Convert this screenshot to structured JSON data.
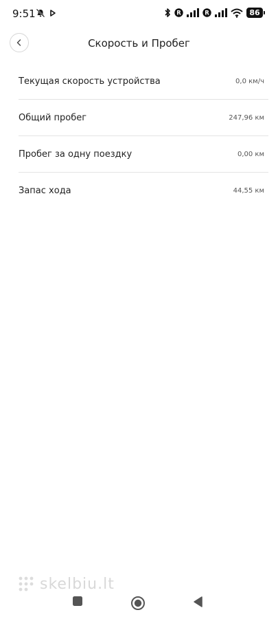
{
  "status_bar": {
    "time": "9:51",
    "battery": "86",
    "icons": [
      "muted-notifications-icon",
      "play-icon",
      "bluetooth-icon",
      "roaming-r-icon",
      "signal-icon",
      "roaming-r-icon",
      "signal-icon",
      "wifi-icon",
      "battery-icon"
    ]
  },
  "header": {
    "title": "Скорость и Пробег",
    "back_icon": "chevron-left-icon"
  },
  "items": [
    {
      "label": "Текущая скорость устройства",
      "value": "0,0 км/ч"
    },
    {
      "label": "Общий пробег",
      "value": "247,96 км"
    },
    {
      "label": "Пробег за одну поездку",
      "value": "0,00 км"
    },
    {
      "label": "Запас хода",
      "value": "44,55 км"
    }
  ],
  "watermark": {
    "text": "skelbiu.lt"
  },
  "nav_bar": {
    "icons": [
      "recent-apps-icon",
      "home-icon",
      "back-icon"
    ]
  }
}
